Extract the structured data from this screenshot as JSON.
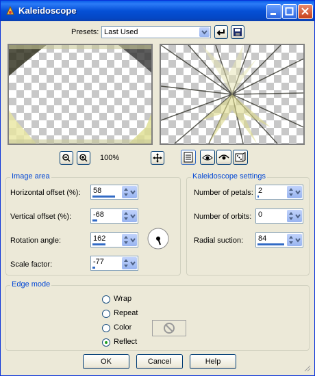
{
  "window": {
    "title": "Kaleidoscope"
  },
  "presets": {
    "label": "Presets:",
    "value": "Last Used"
  },
  "zoom": {
    "level": "100%"
  },
  "image_area": {
    "title": "Image area",
    "horizontal_offset": {
      "label": "Horizontal offset (%):",
      "value": "58",
      "fill": 0.79
    },
    "vertical_offset": {
      "label": "Vertical offset (%):",
      "value": "-68",
      "fill": 0.16
    },
    "rotation_angle": {
      "label": "Rotation angle:",
      "value": "162",
      "fill": 0.45
    },
    "scale_factor": {
      "label": "Scale factor:",
      "value": "-77",
      "fill": 0.1
    }
  },
  "kaleidoscope": {
    "title": "Kaleidoscope settings",
    "petals": {
      "label": "Number of petals:",
      "value": "2",
      "fill": 0.05
    },
    "orbits": {
      "label": "Number of orbits:",
      "value": "0",
      "fill": 0.0
    },
    "radial_suction": {
      "label": "Radial suction:",
      "value": "84",
      "fill": 0.92
    }
  },
  "edge_mode": {
    "title": "Edge mode",
    "options": [
      "Wrap",
      "Repeat",
      "Color",
      "Reflect"
    ],
    "selected": "Reflect"
  },
  "buttons": {
    "ok": "OK",
    "cancel": "Cancel",
    "help": "Help"
  },
  "colors": {
    "accent": "#316ac5",
    "title_blue": "#0550d6"
  }
}
